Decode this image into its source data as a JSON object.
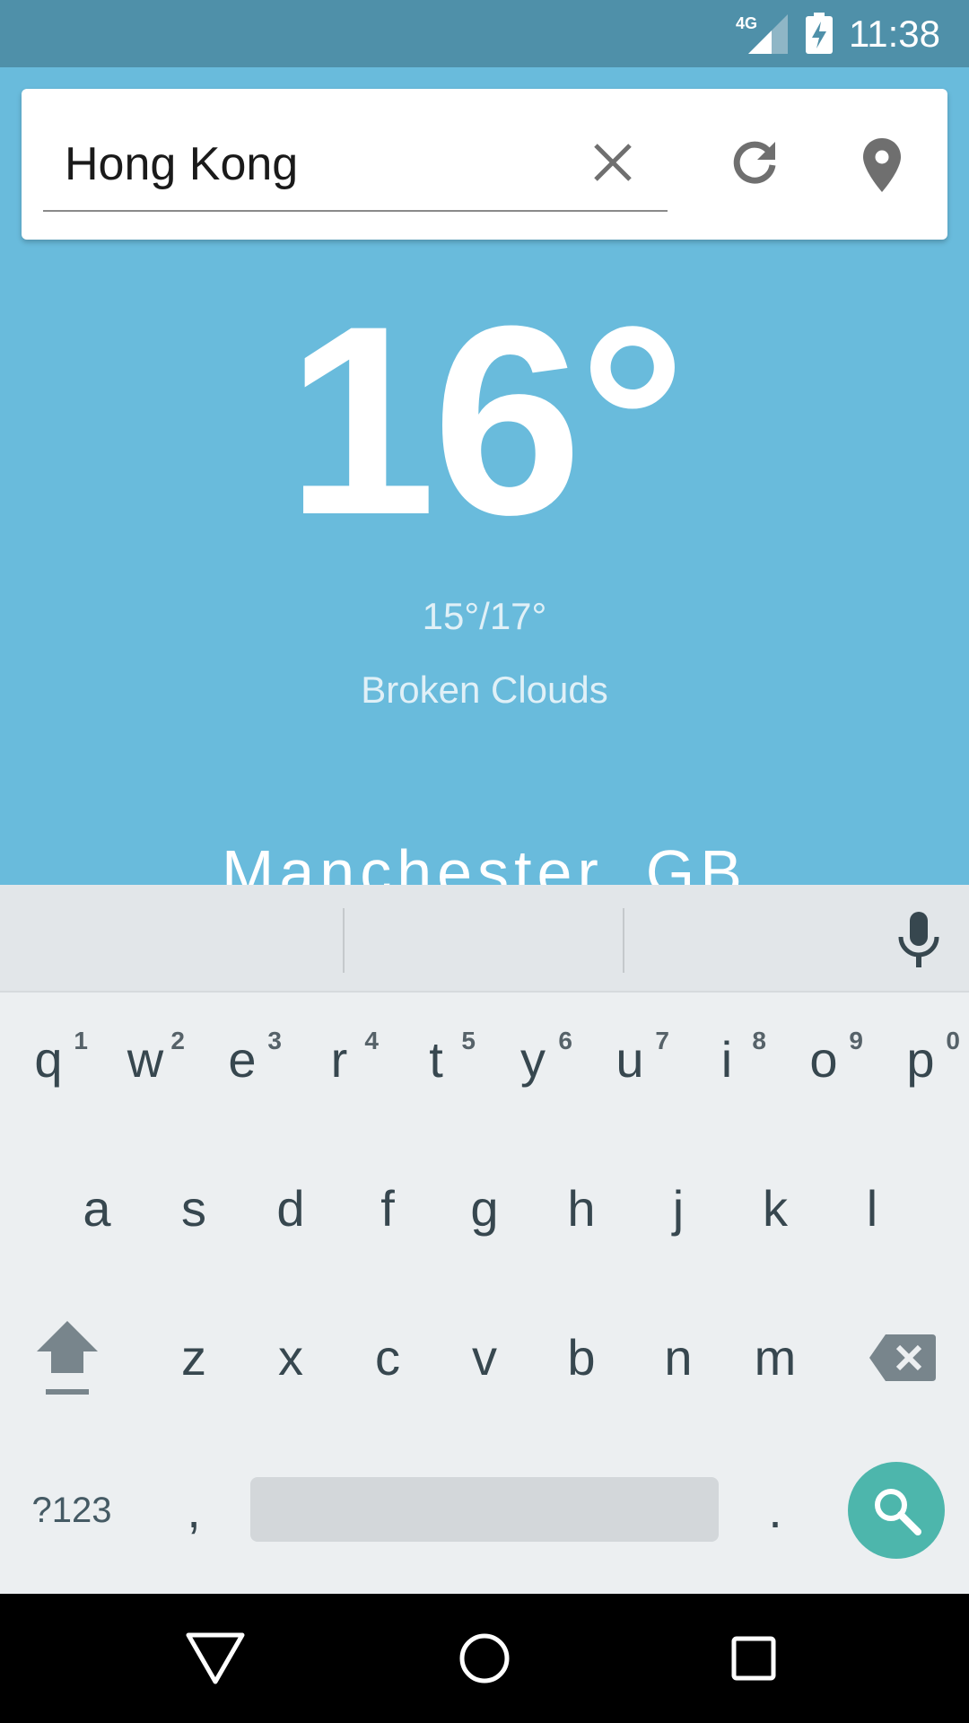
{
  "status_bar": {
    "network": "4G",
    "time": "11:38",
    "icons": [
      "signal-icon",
      "battery-charging-icon"
    ]
  },
  "search": {
    "value": "Hong Kong",
    "icons": [
      "clear-icon",
      "refresh-icon",
      "location-pin-icon"
    ]
  },
  "weather": {
    "temperature": "16°",
    "range": "15°/17°",
    "condition": "Broken Clouds",
    "city": "Manchester, GB"
  },
  "keyboard": {
    "row1": [
      {
        "ch": "q",
        "hint": "1"
      },
      {
        "ch": "w",
        "hint": "2"
      },
      {
        "ch": "e",
        "hint": "3"
      },
      {
        "ch": "r",
        "hint": "4"
      },
      {
        "ch": "t",
        "hint": "5"
      },
      {
        "ch": "y",
        "hint": "6"
      },
      {
        "ch": "u",
        "hint": "7"
      },
      {
        "ch": "i",
        "hint": "8"
      },
      {
        "ch": "o",
        "hint": "9"
      },
      {
        "ch": "p",
        "hint": "0"
      }
    ],
    "row2": [
      "a",
      "s",
      "d",
      "f",
      "g",
      "h",
      "j",
      "k",
      "l"
    ],
    "row3": [
      "z",
      "x",
      "c",
      "v",
      "b",
      "n",
      "m"
    ],
    "symbols_label": "?123",
    "comma": ",",
    "period": ".",
    "icons": [
      "shift-icon",
      "backspace-icon",
      "microphone-icon",
      "search-icon"
    ]
  },
  "nav_bar": {
    "icons": [
      "back-icon",
      "home-icon",
      "recents-icon"
    ]
  },
  "colors": {
    "background": "#69bbdc",
    "status_bar": "#4f90a9",
    "accent": "#4db6ac"
  }
}
